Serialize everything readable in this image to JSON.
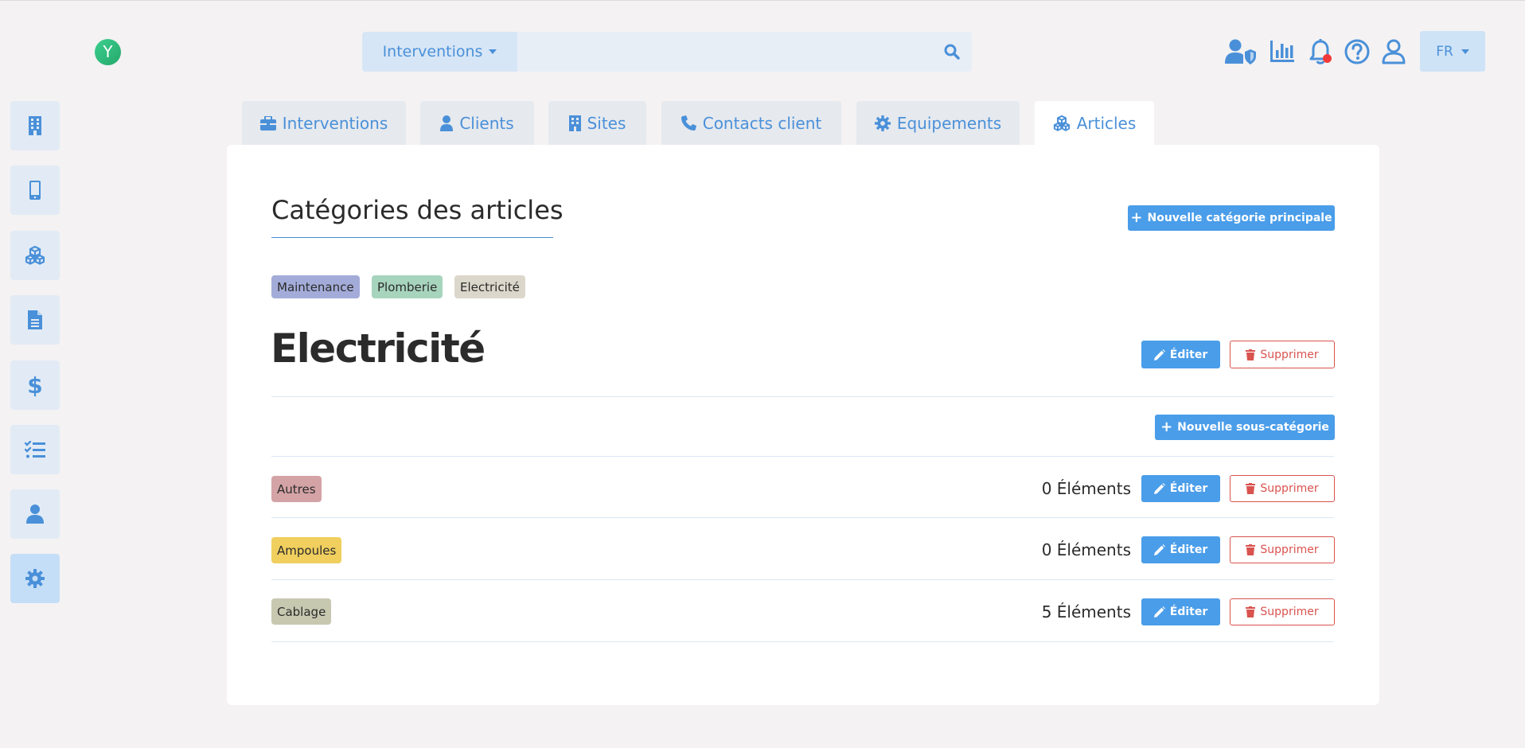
{
  "app": {
    "logo_letter": "Y"
  },
  "search": {
    "scope": "Interventions",
    "placeholder": "",
    "value": ""
  },
  "header": {
    "lang": "FR",
    "accent": "#4a90d9",
    "notification_dot_color": "#f23a3a"
  },
  "sidebar": {
    "items": [
      {
        "icon": "building-icon",
        "active": false
      },
      {
        "icon": "mobile-icon",
        "active": false
      },
      {
        "icon": "cubes-icon",
        "active": false
      },
      {
        "icon": "document-icon",
        "active": false
      },
      {
        "icon": "dollar-icon",
        "active": false
      },
      {
        "icon": "tasks-icon",
        "active": false
      },
      {
        "icon": "user-icon",
        "active": false
      },
      {
        "icon": "gear-icon",
        "active": true
      }
    ]
  },
  "tabs": [
    {
      "label": "Interventions",
      "icon": "briefcase-icon"
    },
    {
      "label": "Clients",
      "icon": "user-icon"
    },
    {
      "label": "Sites",
      "icon": "building-icon"
    },
    {
      "label": "Contacts client",
      "icon": "phone-icon"
    },
    {
      "label": "Equipements",
      "icon": "gear-icon"
    },
    {
      "label": "Articles",
      "icon": "cubes-icon",
      "active": true
    }
  ],
  "page": {
    "title": "Catégories des articles",
    "new_main_label": "Nouvelle catégorie principale",
    "main_categories": [
      {
        "label": "Maintenance",
        "color": "#a3acd9"
      },
      {
        "label": "Plomberie",
        "color": "#a7d4bd"
      },
      {
        "label": "Electricité",
        "color": "#dcd7cb"
      }
    ],
    "selected": {
      "title": "Electricité",
      "edit_label": "Éditer",
      "delete_label": "Supprimer",
      "new_sub_label": "Nouvelle sous-catégorie"
    },
    "subcategories": [
      {
        "label": "Autres",
        "color": "#d4a3a6",
        "count": "0 Éléments",
        "edit_label": "Éditer",
        "delete_label": "Supprimer"
      },
      {
        "label": "Ampoules",
        "color": "#f0cf5e",
        "count": "0 Éléments",
        "edit_label": "Éditer",
        "delete_label": "Supprimer"
      },
      {
        "label": "Cablage",
        "color": "#c7c8b0",
        "count": "5 Éléments",
        "edit_label": "Éditer",
        "delete_label": "Supprimer"
      }
    ]
  }
}
